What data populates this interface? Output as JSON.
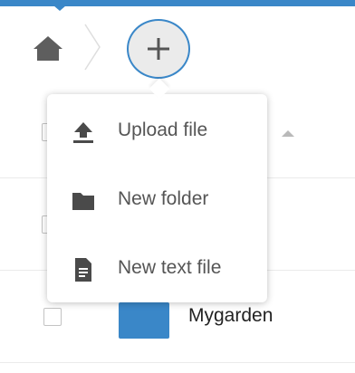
{
  "breadcrumb": {
    "home_icon": "home-icon",
    "separator_icon": "chevron-right-icon"
  },
  "add_button": {
    "icon": "plus-icon"
  },
  "new_menu": {
    "items": [
      {
        "label": "Upload file",
        "icon": "upload-icon"
      },
      {
        "label": "New folder",
        "icon": "folder-icon"
      },
      {
        "label": "New text file",
        "icon": "text-file-icon"
      }
    ]
  },
  "file_list": {
    "sort_indicator": "sort-ascending-icon",
    "rows": [
      {
        "name": "Mygarden",
        "type": "folder"
      }
    ]
  },
  "colors": {
    "accent": "#3a87c8",
    "icon_gray": "#4a4a4a",
    "menu_text": "#555555"
  }
}
